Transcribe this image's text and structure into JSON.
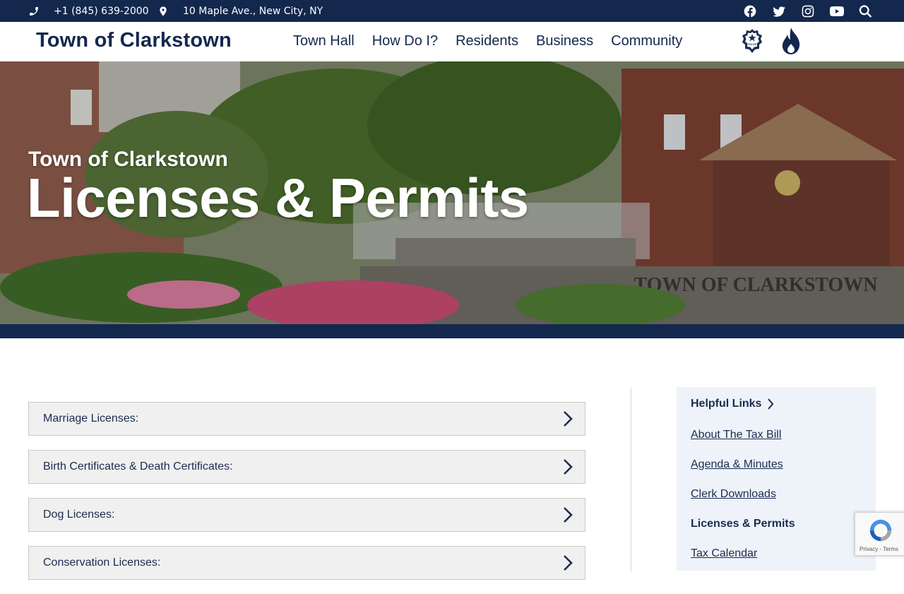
{
  "topbar": {
    "phone": "+1 (845) 639-2000",
    "address": "10 Maple Ave., New City, NY"
  },
  "header": {
    "brand": "Town of Clarkstown",
    "nav": [
      "Town Hall",
      "How Do I?",
      "Residents",
      "Business",
      "Community"
    ],
    "police_badge_text": "POLICE"
  },
  "hero": {
    "subtitle": "Town of Clarkstown",
    "title": "Licenses & Permits"
  },
  "accordion": [
    "Marriage Licenses:",
    "Birth Certificates & Death Certificates:",
    "Dog Licenses:",
    "Conservation Licenses:"
  ],
  "sidebar": {
    "heading": "Helpful Links",
    "links": [
      "About The Tax Bill",
      "Agenda & Minutes",
      "Clerk Downloads",
      "Licenses & Permits",
      "Tax Calendar"
    ],
    "active": "Licenses & Permits"
  },
  "recaptcha": {
    "text": "Privacy - Terms"
  },
  "colors": {
    "navy": "#14284e",
    "panel": "#f0f0f0",
    "sidebar": "#eef3fa"
  }
}
